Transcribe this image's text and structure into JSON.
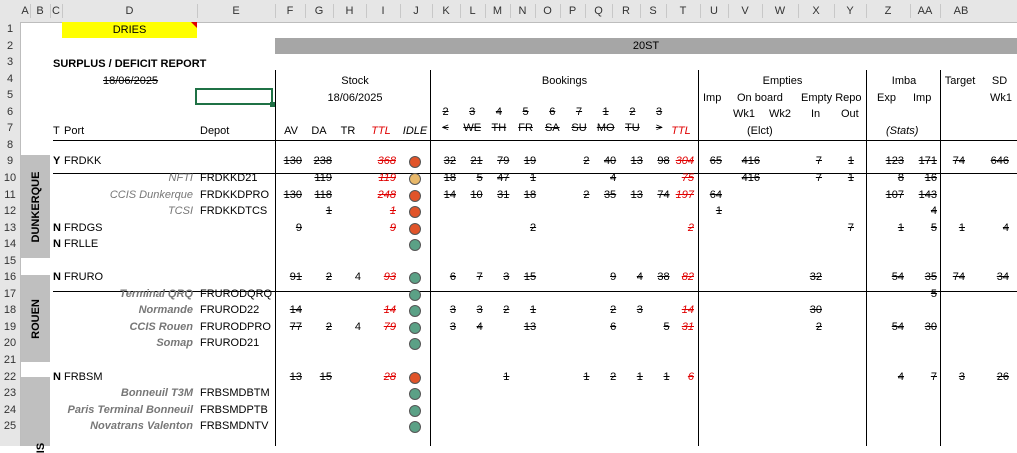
{
  "colors": {
    "red": "#e00000",
    "green": "#5ba186",
    "orange": "#e0542a",
    "amber": "#e8b86a",
    "header_bar": "#a6a6a6",
    "yellow": "#ffff00"
  },
  "cols": [
    "A",
    "B",
    "C",
    "D",
    "E",
    "F",
    "G",
    "H",
    "I",
    "J",
    "K",
    "L",
    "M",
    "N",
    "O",
    "P",
    "Q",
    "R",
    "S",
    "T",
    "U",
    "V",
    "W",
    "X",
    "Y",
    "Z",
    "AA",
    "AB"
  ],
  "rows": [
    "1",
    "2",
    "3",
    "4",
    "5",
    "6",
    "7",
    "8",
    "9",
    "10",
    "11",
    "12",
    "13",
    "14",
    "15",
    "16",
    "17",
    "18",
    "19",
    "20",
    "21",
    "22",
    "23",
    "24",
    "25"
  ],
  "header": {
    "dries": "DRIES",
    "band_20st": "20ST",
    "title": "SURPLUS / DEFICIT REPORT",
    "date": "18/06/2025",
    "stock": "Stock",
    "stock_date": "18/06/2025",
    "bookings": "Bookings",
    "empties": "Empties",
    "imba": "Imba",
    "target": "Target",
    "sd": "SD",
    "imp": "Imp",
    "on_board": "On board",
    "empty_repo": "Empty Repo",
    "exp": "Exp",
    "imp2": "Imp",
    "wk1": "Wk1",
    "wk1b": "Wk1",
    "wk2": "Wk2",
    "in": "In",
    "out": "Out",
    "elct": "(Elct)",
    "stats": "(Stats)",
    "t": "T",
    "port": "Port",
    "depot": "Depot",
    "av": "AV",
    "da": "DA",
    "tr": "TR",
    "ttl": "TTL",
    "idle": "IDLE",
    "bk_nums": [
      "2",
      "3",
      "4",
      "5",
      "6",
      "7",
      "1",
      "2",
      "3"
    ],
    "bk_days": [
      "<",
      "WE",
      "TH",
      "FR",
      "SA",
      "SU",
      "MO",
      "TU",
      ">"
    ],
    "ttl2": "TTL"
  },
  "regions": {
    "dunkerque": "DUNKERQUE",
    "rouen": "ROUEN",
    "paris": "IS"
  },
  "rows_data": [
    {
      "row": 9,
      "t": "Y",
      "port": "FRDKK",
      "depot": "",
      "av": "130",
      "da": "238",
      "tr": "",
      "ttl": "368",
      "idle": "orange",
      "bk": [
        "32",
        "21",
        "79",
        "19",
        "",
        "2",
        "40",
        "13",
        "98"
      ],
      "bttl": "304",
      "imp": "65",
      "wk1": "416",
      "wk2": "",
      "ein": "7",
      "eout": "1",
      "exp": "123",
      "impb": "171",
      "target": "74",
      "sd": "646"
    },
    {
      "row": 10,
      "t": "",
      "port": "NFTI",
      "depot": "FRDKKD21",
      "av": "",
      "da": "119",
      "tr": "",
      "ttl": "119",
      "idle": "amber",
      "bk": [
        "18",
        "5",
        "47",
        "1",
        "",
        "",
        "4",
        "",
        ""
      ],
      "bttl": "75",
      "imp": "",
      "wk1": "416",
      "wk2": "",
      "ein": "7",
      "eout": "1",
      "exp": "8",
      "impb": "16",
      "target": "",
      "sd": ""
    },
    {
      "row": 11,
      "t": "",
      "port": "CCIS Dunkerque",
      "depot": "FRDKKDPRO",
      "av": "130",
      "da": "118",
      "tr": "",
      "ttl": "248",
      "idle": "orange",
      "bk": [
        "14",
        "10",
        "31",
        "18",
        "",
        "2",
        "35",
        "13",
        "74"
      ],
      "bttl": "197",
      "imp": "64",
      "wk1": "",
      "wk2": "",
      "ein": "",
      "eout": "",
      "exp": "107",
      "impb": "143",
      "target": "",
      "sd": ""
    },
    {
      "row": 12,
      "t": "",
      "port": "TCSI",
      "depot": "FRDKKDTCS",
      "av": "",
      "da": "1",
      "tr": "",
      "ttl": "1",
      "idle": "orange",
      "bk": [
        "",
        "",
        "",
        "",
        "",
        "",
        "",
        "",
        ""
      ],
      "bttl": "",
      "imp": "1",
      "wk1": "",
      "wk2": "",
      "ein": "",
      "eout": "",
      "exp": "",
      "impb": "4",
      "target": "",
      "sd": ""
    },
    {
      "row": 13,
      "t": "N",
      "port": "FRDGS",
      "depot": "",
      "av": "9",
      "da": "",
      "tr": "",
      "ttl": "9",
      "idle": "orange",
      "bk": [
        "",
        "",
        "",
        "2",
        "",
        "",
        "",
        "",
        ""
      ],
      "bttl": "2",
      "imp": "",
      "wk1": "",
      "wk2": "",
      "ein": "",
      "eout": "7",
      "exp": "1",
      "impb": "5",
      "target": "1",
      "sd": "4"
    },
    {
      "row": 14,
      "t": "N",
      "port": "FRLLE",
      "depot": "",
      "av": "",
      "da": "",
      "tr": "",
      "ttl": "",
      "idle": "green",
      "bk": [
        "",
        "",
        "",
        "",
        "",
        "",
        "",
        "",
        ""
      ],
      "bttl": "",
      "imp": "",
      "wk1": "",
      "wk2": "",
      "ein": "",
      "eout": "",
      "exp": "",
      "impb": "",
      "target": "",
      "sd": ""
    },
    {
      "row": 16,
      "t": "N",
      "port": "FRURO",
      "depot": "",
      "av": "91",
      "da": "2",
      "tr": "4",
      "ttl": "93",
      "idle": "green",
      "bk": [
        "6",
        "7",
        "3",
        "15",
        "",
        "",
        "9",
        "4",
        "38"
      ],
      "bttl": "82",
      "imp": "",
      "wk1": "",
      "wk2": "",
      "ein": "32",
      "eout": "",
      "exp": "54",
      "impb": "35",
      "target": "74",
      "sd": "34"
    },
    {
      "row": 17,
      "t": "",
      "port": "Terminal QRQ",
      "depot": "FRURODQRQ",
      "av": "",
      "da": "",
      "tr": "",
      "ttl": "",
      "idle": "green",
      "bk": [
        "",
        "",
        "",
        "",
        "",
        "",
        "",
        "",
        ""
      ],
      "bttl": "",
      "imp": "",
      "wk1": "",
      "wk2": "",
      "ein": "",
      "eout": "",
      "exp": "",
      "impb": "5",
      "target": "",
      "sd": ""
    },
    {
      "row": 18,
      "t": "",
      "port": "Normande",
      "depot": "FRUROD22",
      "av": "14",
      "da": "",
      "tr": "",
      "ttl": "14",
      "idle": "green",
      "bk": [
        "3",
        "3",
        "2",
        "1",
        "",
        "",
        "2",
        "3",
        ""
      ],
      "bttl": "14",
      "imp": "",
      "wk1": "",
      "wk2": "",
      "ein": "30",
      "eout": "",
      "exp": "",
      "impb": "",
      "target": "",
      "sd": ""
    },
    {
      "row": 19,
      "t": "",
      "port": "CCIS Rouen",
      "depot": "FRURODPRO",
      "av": "77",
      "da": "2",
      "tr": "4",
      "ttl": "79",
      "idle": "green",
      "bk": [
        "3",
        "4",
        "",
        "13",
        "",
        "",
        "6",
        "",
        "5"
      ],
      "bttl": "31",
      "imp": "",
      "wk1": "",
      "wk2": "",
      "ein": "2",
      "eout": "",
      "exp": "54",
      "impb": "30",
      "target": "",
      "sd": ""
    },
    {
      "row": 20,
      "t": "",
      "port": "Somap",
      "depot": "FRUROD21",
      "av": "",
      "da": "",
      "tr": "",
      "ttl": "",
      "idle": "green",
      "bk": [
        "",
        "",
        "",
        "",
        "",
        "",
        "",
        "",
        ""
      ],
      "bttl": "",
      "imp": "",
      "wk1": "",
      "wk2": "",
      "ein": "",
      "eout": "",
      "exp": "",
      "impb": "",
      "target": "",
      "sd": ""
    },
    {
      "row": 22,
      "t": "N",
      "port": "FRBSM",
      "depot": "",
      "av": "13",
      "da": "15",
      "tr": "",
      "ttl": "28",
      "idle": "orange",
      "bk": [
        "",
        "",
        "1",
        "",
        "",
        "1",
        "2",
        "1",
        "1"
      ],
      "bttl": "6",
      "imp": "",
      "wk1": "",
      "wk2": "",
      "ein": "",
      "eout": "",
      "exp": "4",
      "impb": "7",
      "target": "3",
      "sd": "26"
    },
    {
      "row": 23,
      "t": "",
      "port": "Bonneuil T3M",
      "depot": "FRBSMDBTM",
      "av": "",
      "da": "",
      "tr": "",
      "ttl": "",
      "idle": "green",
      "bk": [
        "",
        "",
        "",
        "",
        "",
        "",
        "",
        "",
        ""
      ],
      "bttl": "",
      "imp": "",
      "wk1": "",
      "wk2": "",
      "ein": "",
      "eout": "",
      "exp": "",
      "impb": "",
      "target": "",
      "sd": ""
    },
    {
      "row": 24,
      "t": "",
      "port": "Paris Terminal Bonneuil",
      "depot": "FRBSMDPTB",
      "av": "",
      "da": "",
      "tr": "",
      "ttl": "",
      "idle": "green",
      "bk": [
        "",
        "",
        "",
        "",
        "",
        "",
        "",
        "",
        ""
      ],
      "bttl": "",
      "imp": "",
      "wk1": "",
      "wk2": "",
      "ein": "",
      "eout": "",
      "exp": "",
      "impb": "",
      "target": "",
      "sd": ""
    },
    {
      "row": 25,
      "t": "",
      "port": "Novatrans Valenton",
      "depot": "FRBSMDNTV",
      "av": "",
      "da": "",
      "tr": "",
      "ttl": "",
      "idle": "green",
      "bk": [
        "",
        "",
        "",
        "",
        "",
        "",
        "",
        "",
        ""
      ],
      "bttl": "",
      "imp": "",
      "wk1": "",
      "wk2": "",
      "ein": "",
      "eout": "",
      "exp": "",
      "impb": "",
      "target": "",
      "sd": ""
    }
  ]
}
